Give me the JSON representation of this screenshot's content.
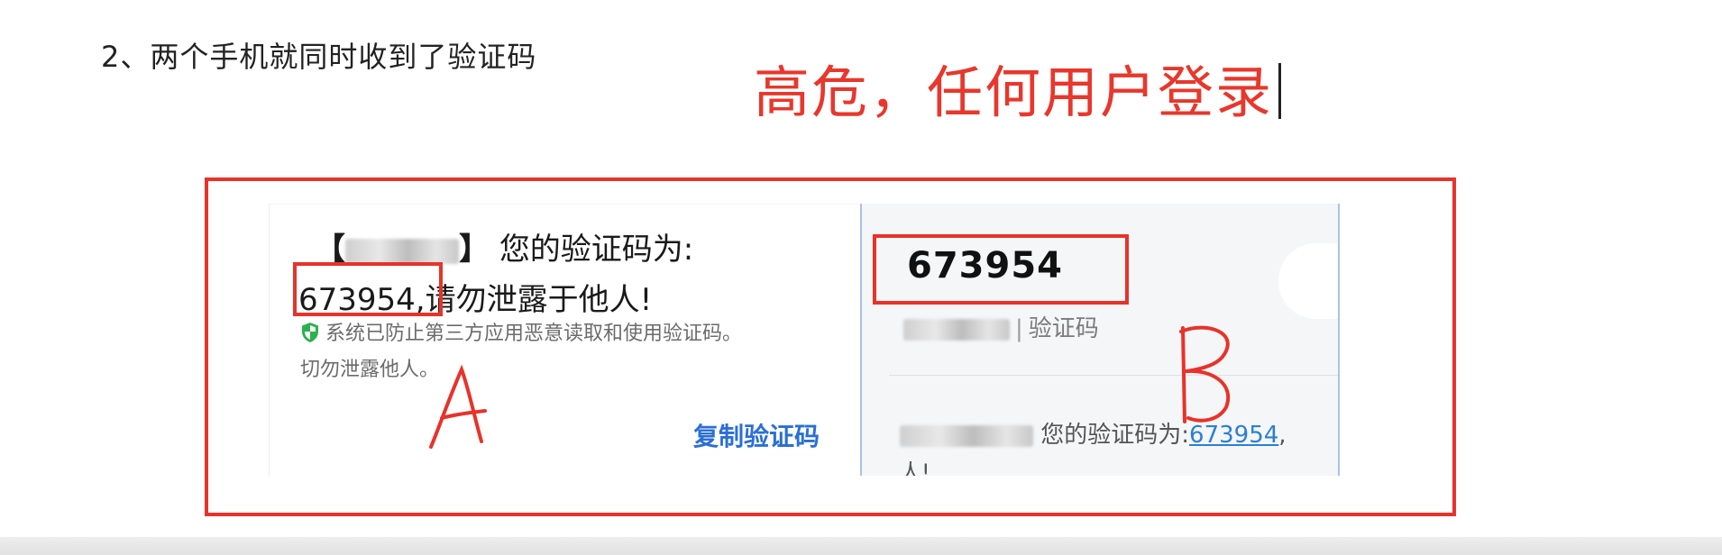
{
  "heading": "2、两个手机就同时收到了验证码",
  "warning": "高危，任何用户登录",
  "phone_a": {
    "bracket_open": "【",
    "bracket_close": "】",
    "line1": "您的验证码为:",
    "code": "673954,",
    "line2": "请勿泄露于他人!",
    "notice1": "系统已防止第三方应用恶意读取和使用验证码。",
    "notice2": "切勿泄露他人。",
    "copy_button": "复制验证码",
    "label": "A"
  },
  "phone_b": {
    "code": "673954",
    "sender_suffix": "验证码",
    "message_prefix": "您的验证码为:",
    "message_code": "673954",
    "message_suffix": ",",
    "message_line2": "人!",
    "label": "B"
  },
  "colors": {
    "highlight_red": "#e8322a",
    "warning_red": "#e8372c",
    "link_blue": "#2a7fd6",
    "shield_green": "#2bb24c"
  }
}
